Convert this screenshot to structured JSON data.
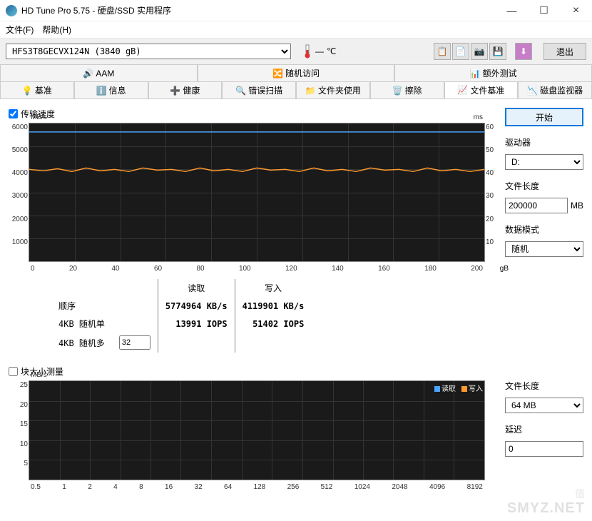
{
  "window": {
    "title": "HD Tune Pro 5.75 - 硬盘/SSD 实用程序"
  },
  "menu": {
    "file": "文件(F)",
    "help": "帮助(H)"
  },
  "toolbar": {
    "drive": "HFS3T8GECVX124N (3840 gB)",
    "temp_dash": "—",
    "temp_unit": "℃",
    "exit": "退出"
  },
  "tabs_top": [
    "AAM",
    "随机访问",
    "额外测试"
  ],
  "tabs_bottom": [
    "基准",
    "信息",
    "健康",
    "错误扫描",
    "文件夹使用",
    "擦除",
    "文件基准",
    "磁盘监视器"
  ],
  "checkbox1": "传输速度",
  "checkbox2": "块大小测量",
  "side": {
    "start": "开始",
    "drive_label": "驱动器",
    "drive_value": "D:",
    "filelen_label": "文件长度",
    "filelen_value": "200000",
    "filelen_unit": "MB",
    "datamode_label": "数据模式",
    "datamode_value": "随机",
    "filelen2_label": "文件长度",
    "filelen2_value": "64 MB",
    "delay_label": "延迟",
    "delay_value": "0"
  },
  "table": {
    "read_hdr": "读取",
    "write_hdr": "写入",
    "seq_label": "顺序",
    "seq_read": "5774964 KB/s",
    "seq_write": "4119901 KB/s",
    "rnd1_label": "4KB 随机单",
    "rnd1_read": "13991 IOPS",
    "rnd1_write": "51402 IOPS",
    "rndm_label": "4KB 随机多",
    "rndm_spin": "32"
  },
  "chart_data": [
    {
      "type": "line",
      "title": "传输速度",
      "ylabel": "MB/s",
      "ylim": [
        0,
        6000
      ],
      "y2label": "ms",
      "y2lim": [
        0,
        60
      ],
      "xlabel": "gB",
      "xlim": [
        0,
        200
      ],
      "x_ticks": [
        0,
        20,
        40,
        60,
        80,
        100,
        120,
        140,
        160,
        180,
        200
      ],
      "y_ticks": [
        1000,
        2000,
        3000,
        4000,
        5000,
        6000
      ],
      "y2_ticks": [
        10,
        20,
        30,
        40,
        50,
        60
      ],
      "series": [
        {
          "name": "读取",
          "color": "#4aa3ff",
          "values": [
            5650,
            5650,
            5650,
            5650,
            5650,
            5650,
            5650,
            5650,
            5650,
            5650,
            5650
          ]
        },
        {
          "name": "写入",
          "color": "#ff9a2e",
          "values": [
            4050,
            4000,
            4050,
            3950,
            4050,
            4000,
            4050,
            3950,
            4050,
            4000,
            4050
          ]
        }
      ]
    },
    {
      "type": "line",
      "title": "块大小测量",
      "ylabel": "MB/s",
      "ylim": [
        0,
        25
      ],
      "x_ticks": [
        "0.5",
        "1",
        "2",
        "4",
        "8",
        "16",
        "32",
        "64",
        "128",
        "256",
        "512",
        "1024",
        "2048",
        "4096",
        "8192"
      ],
      "y_ticks": [
        5,
        10,
        15,
        20,
        25
      ],
      "legend": [
        {
          "name": "读取",
          "color": "#4aa3ff"
        },
        {
          "name": "写入",
          "color": "#ff9a2e"
        }
      ],
      "series": []
    }
  ],
  "watermark": {
    "line1": "值",
    "line2": "SMYZ.NET"
  }
}
